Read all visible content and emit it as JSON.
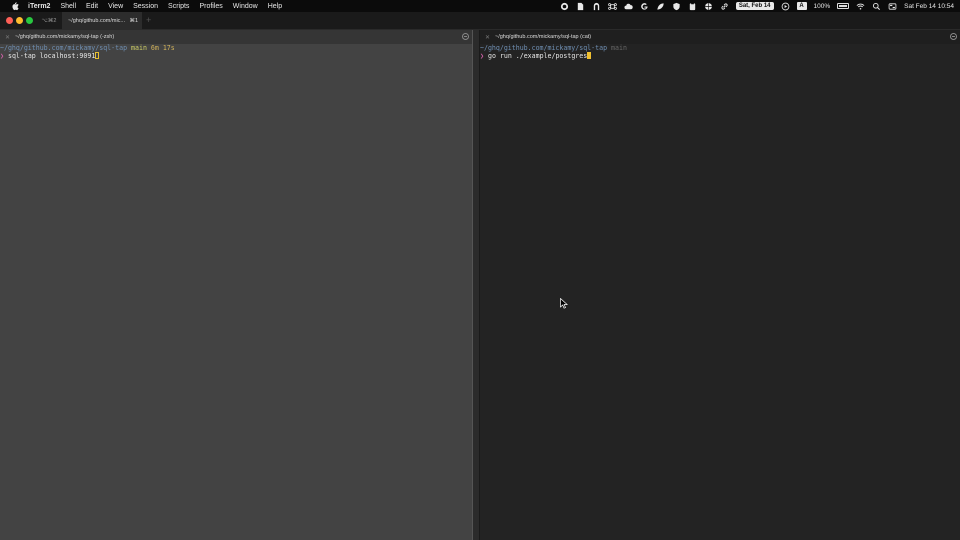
{
  "menubar": {
    "app_name": "iTerm2",
    "items": [
      "Shell",
      "Edit",
      "View",
      "Session",
      "Scripts",
      "Profiles",
      "Window",
      "Help"
    ],
    "date_pill": "Sat, Feb 14",
    "input_source": "A",
    "battery": "100%",
    "clock": "Sat Feb 14  10:54"
  },
  "tabs": [
    {
      "label": "⌥⌘2",
      "active": false
    },
    {
      "label": "~/ghq/github.com/mic...",
      "shortcut": "⌘1",
      "active": true
    }
  ],
  "panes": {
    "left": {
      "title": "~/ghq/github.com/mickamy/sql-tap (-zsh)",
      "path": "~/ghq/github.com/mickamy/sql-tap",
      "branch": "main",
      "duration": "6m 17s",
      "prompt": "❯",
      "command": "sql-tap localhost:9091"
    },
    "right": {
      "title": "~/ghq/github.com/mickamy/sql-tap (cat)",
      "path": "~/ghq/github.com/mickamy/sql-tap",
      "branch": "main",
      "prompt": "❯",
      "command": "go run ./example/postgres"
    }
  },
  "colors": {
    "path": "#6f8fb3",
    "branch": "#cfcf66",
    "prompt": "#d060a8",
    "cursor": "#f0c030"
  }
}
